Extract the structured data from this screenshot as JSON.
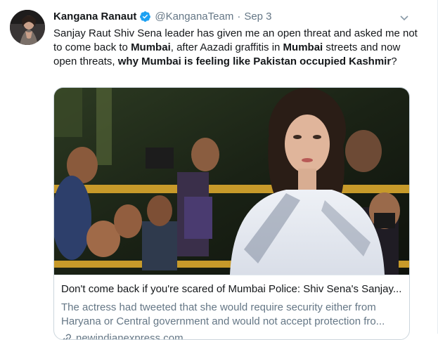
{
  "tweet": {
    "display_name": "Kangana Ranaut",
    "handle": "@KanganaTeam",
    "separator": "·",
    "time": "Sep 3",
    "verified_icon": "verified-badge-icon",
    "menu_icon": "chevron-down-icon",
    "text": {
      "p1": "Sanjay Raut Shiv Sena leader has given me an open threat and asked me not to come back to ",
      "b1": "Mumbai",
      "p2": ", after Aazadi graffitis in ",
      "b2": "Mumbai",
      "p3": " streets and now open threats, ",
      "b3": "why Mumbai is feeling like Pakistan occupied Kashmir",
      "p4": "?"
    }
  },
  "card": {
    "title": "Don't come back if you're scared of Mumbai Police: Shiv Sena's Sanjay...",
    "description": "The actress had tweeted that she would require security either from Haryana or Central government and would not accept protection fro...",
    "domain": "newindianexpress.com",
    "domain_icon": "link-icon"
  },
  "colors": {
    "text": "#14171a",
    "muted": "#657786",
    "verified": "#1da1f2",
    "border": "#ccd6dd"
  }
}
